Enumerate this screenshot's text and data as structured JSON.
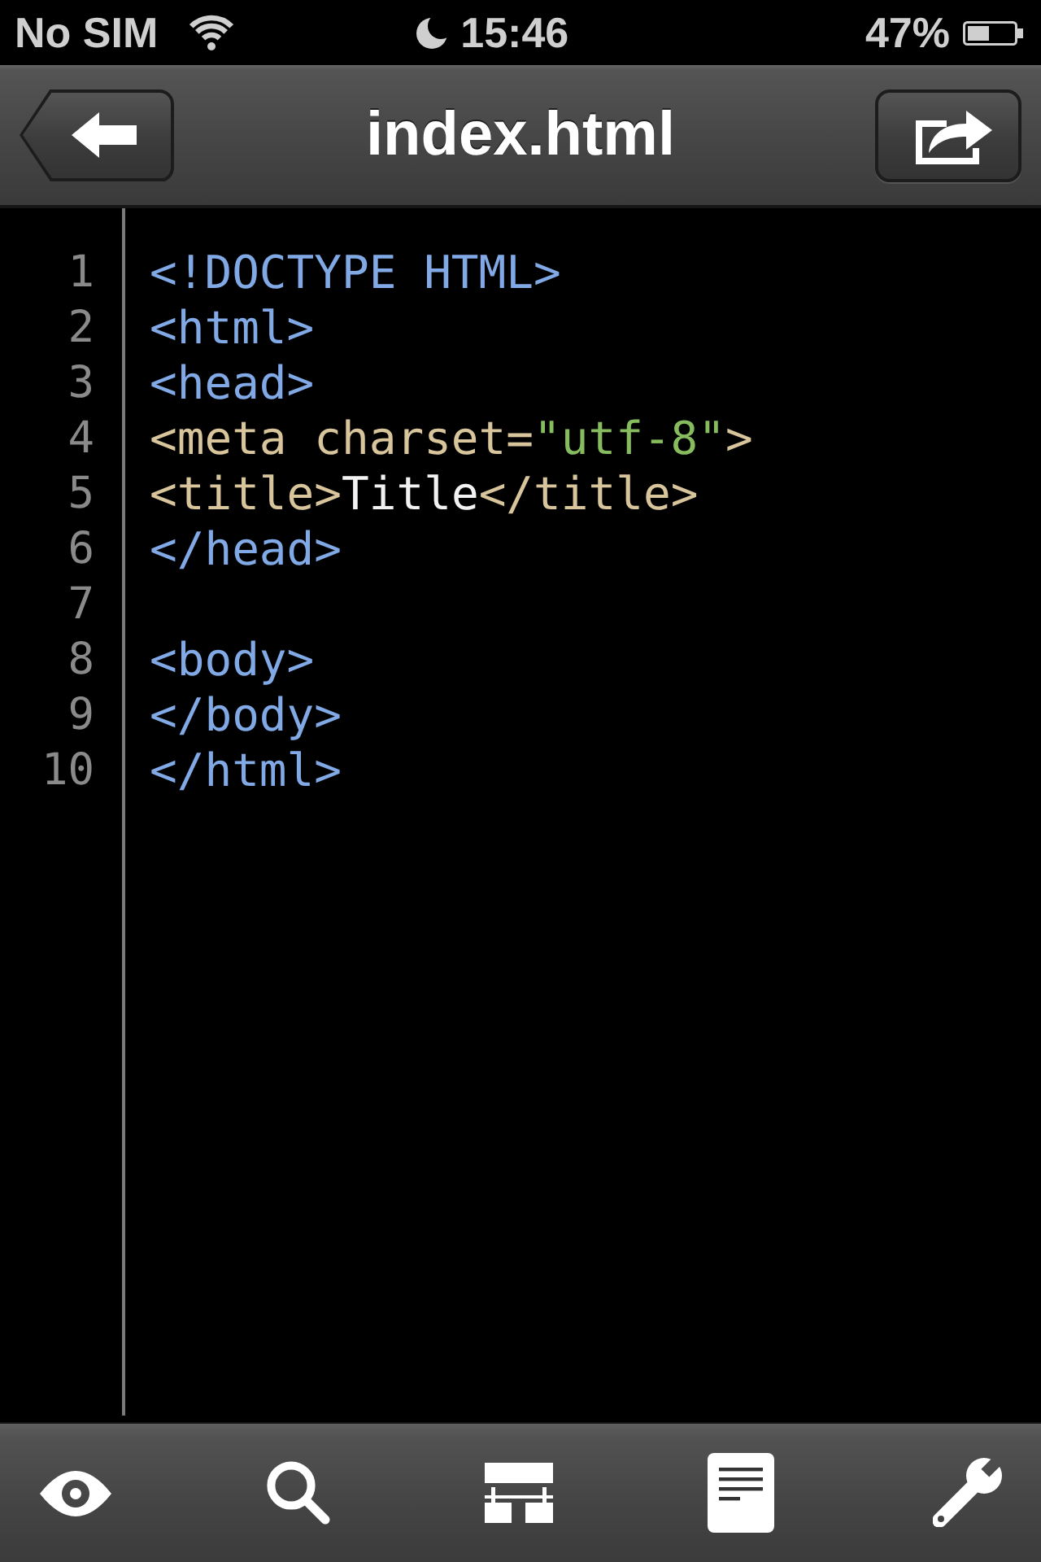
{
  "status_bar": {
    "carrier": "No SIM",
    "time": "15:46",
    "battery_percent": "47%"
  },
  "nav_bar": {
    "title": "index.html"
  },
  "editor": {
    "lines": [
      {
        "number": "1",
        "tokens": [
          {
            "kind": "tag",
            "text": "<!DOCTYPE HTML>"
          }
        ]
      },
      {
        "number": "2",
        "tokens": [
          {
            "kind": "tag",
            "text": "<html>"
          }
        ]
      },
      {
        "number": "3",
        "tokens": [
          {
            "kind": "tag",
            "text": "<head>"
          }
        ]
      },
      {
        "number": "4",
        "tokens": [
          {
            "kind": "meta",
            "text": "<meta charset="
          },
          {
            "kind": "string",
            "text": "\"utf-8\""
          },
          {
            "kind": "meta",
            "text": ">"
          }
        ]
      },
      {
        "number": "5",
        "tokens": [
          {
            "kind": "meta",
            "text": "<title>"
          },
          {
            "kind": "text",
            "text": "Title"
          },
          {
            "kind": "meta",
            "text": "</title>"
          }
        ]
      },
      {
        "number": "6",
        "tokens": [
          {
            "kind": "tag",
            "text": "</head>"
          }
        ]
      },
      {
        "number": "7"
      },
      {
        "number": "8",
        "tokens": [
          {
            "kind": "tag",
            "text": "<body>"
          }
        ]
      },
      {
        "number": "9",
        "tokens": [
          {
            "kind": "tag",
            "text": "</body>"
          }
        ]
      },
      {
        "number": "10",
        "tokens": [
          {
            "kind": "tag",
            "text": "</html>"
          }
        ]
      }
    ]
  }
}
